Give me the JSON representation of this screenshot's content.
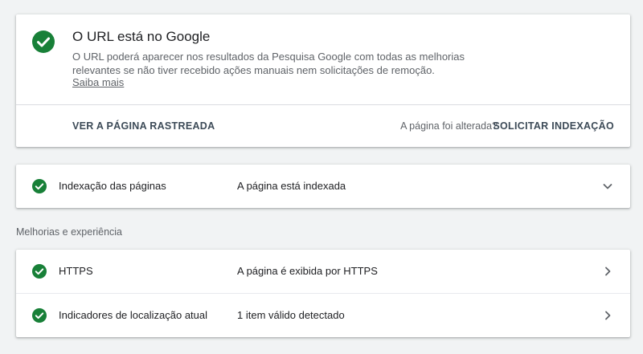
{
  "summary": {
    "title": "O URL está no Google",
    "description": "O URL poderá aparecer nos resultados da Pesquisa Google com todas as melhorias relevantes se não tiver recebido ações manuais nem solicitações de remoção.",
    "learn_more": "Saiba mais",
    "view_crawled_label": "VER A PÁGINA RASTREADA",
    "page_changed_text": "A página foi alterada?",
    "request_indexing_label": "SOLICITAR INDEXAÇÃO"
  },
  "indexing": {
    "name": "Indexação das páginas",
    "status": "A página está indexada"
  },
  "enhancements": {
    "section_label": "Melhorias e experiência",
    "items": [
      {
        "name": "HTTPS",
        "status": "A página é exibida por HTTPS"
      },
      {
        "name": "Indicadores de localização atual",
        "status": "1 item válido detectado"
      }
    ]
  },
  "colors": {
    "success": "#188038",
    "accent_text": "#3c4a57"
  },
  "icons": {
    "status": "check-circle-icon",
    "expand": "chevron-down-icon",
    "navigate": "chevron-right-icon"
  }
}
